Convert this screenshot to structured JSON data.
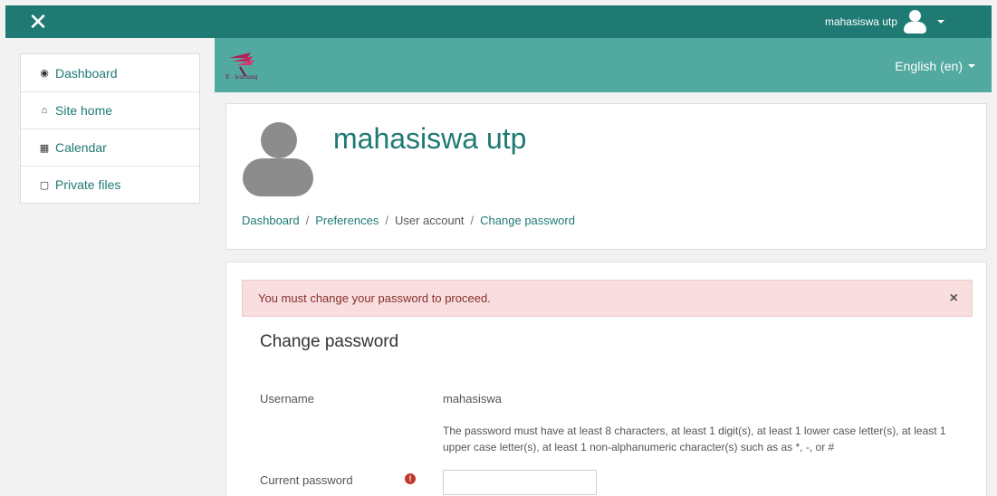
{
  "topbar": {
    "close_glyph": "✕",
    "username": "mahasiswa utp"
  },
  "sidebar": {
    "items": [
      {
        "label": "Dashboard",
        "icon": "dashboard-icon",
        "glyph": "◉"
      },
      {
        "label": "Site home",
        "icon": "home-icon",
        "glyph": "⌂"
      },
      {
        "label": "Calendar",
        "icon": "calendar-icon",
        "glyph": "▦"
      },
      {
        "label": "Private files",
        "icon": "file-icon",
        "glyph": "▢"
      }
    ]
  },
  "header": {
    "logo_text": "E - learning",
    "language": "English (en)"
  },
  "profile": {
    "name": "mahasiswa utp",
    "breadcrumb": [
      "Dashboard",
      "Preferences",
      "User account",
      "Change password"
    ]
  },
  "form": {
    "alert": "You must change your password to proceed.",
    "alert_close": "×",
    "title": "Change password",
    "username_label": "Username",
    "username_value": "mahasiswa",
    "password_rules": "The password must have at least 8 characters, at least 1 digit(s), at least 1 lower case letter(s), at least 1 upper case letter(s), at least 1 non-alphanumeric character(s) such as as *, -, or #",
    "current_password_label": "Current password",
    "required_glyph": "!",
    "current_password_value": ""
  },
  "colors": {
    "navbar": "#1f7a74",
    "header_band": "#52a99f",
    "link": "#1f7a74",
    "alert_bg": "#f8dede",
    "required": "#c0392b"
  }
}
